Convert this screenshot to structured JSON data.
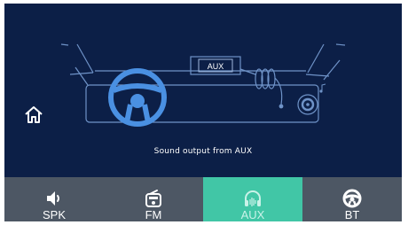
{
  "source": {
    "badge_label": "AUX",
    "status_text": "Sound output from AUX"
  },
  "home": {
    "icon": "home-icon"
  },
  "tabs": [
    {
      "label": "SPK",
      "icon": "speaker-icon",
      "active": false
    },
    {
      "label": "FM",
      "icon": "radio-icon",
      "active": false
    },
    {
      "label": "AUX",
      "icon": "headphones-icon",
      "active": true
    },
    {
      "label": "BT",
      "icon": "steering-wheel-icon",
      "active": false
    }
  ],
  "colors": {
    "background": "#0c1f47",
    "line": "#6f93c8",
    "accent_blue": "#4a90e2",
    "tabbar": "#4d5764",
    "active_tab": "#41c6a6"
  }
}
